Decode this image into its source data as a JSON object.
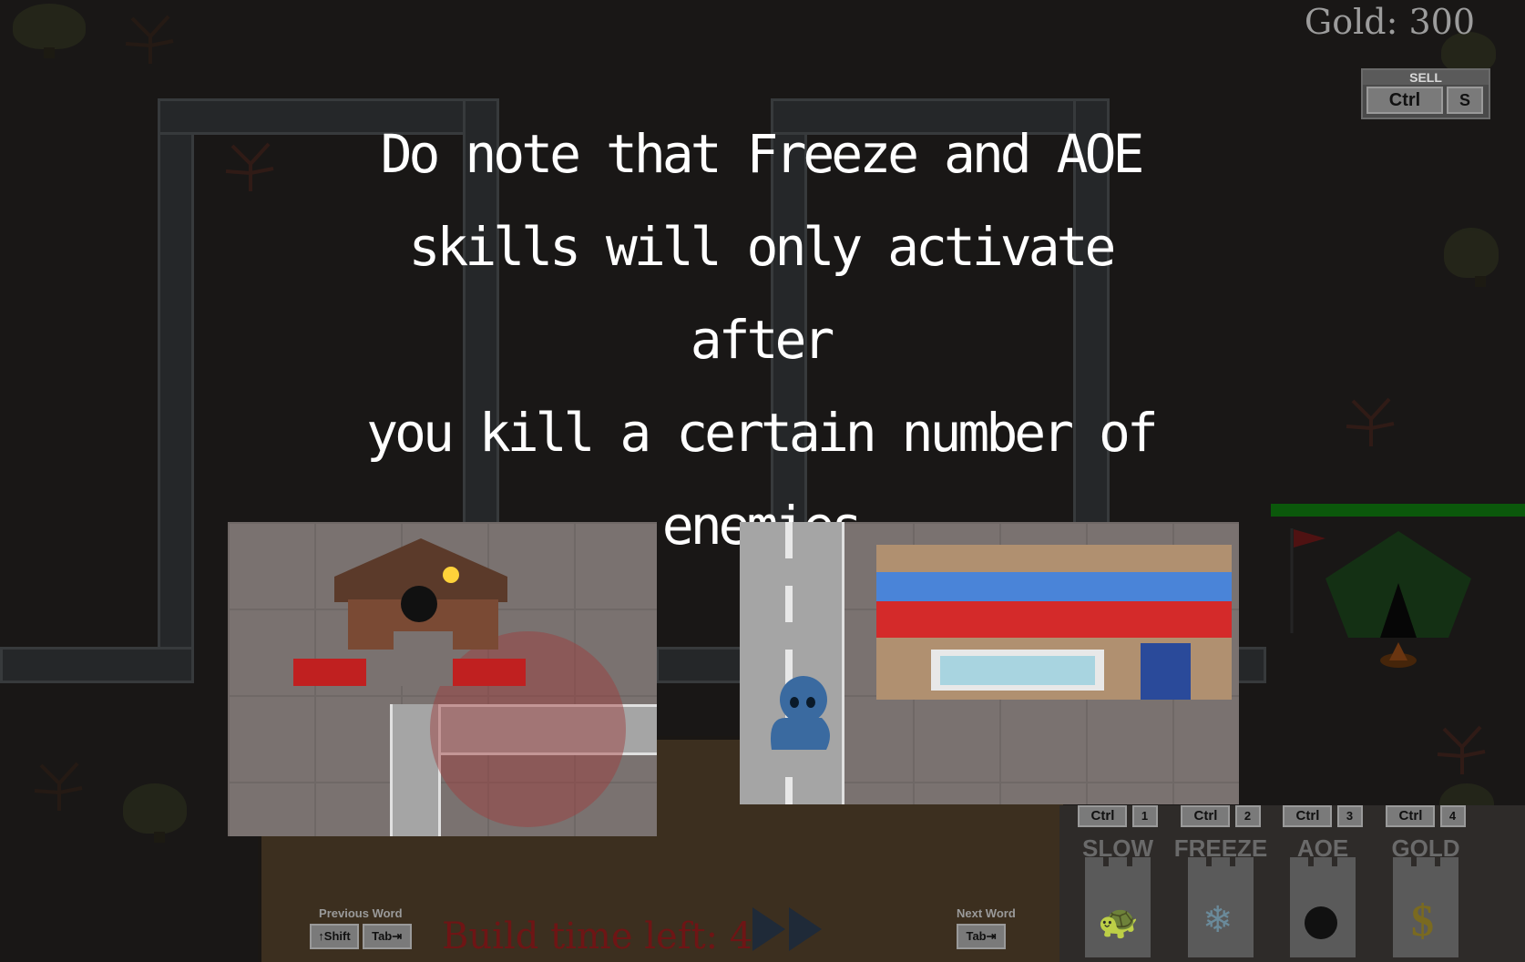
{
  "hud": {
    "gold": "Gold: 300",
    "sell": {
      "label": "SELL",
      "modifier": "Ctrl",
      "key": "S"
    }
  },
  "tutorial": {
    "lines": [
      "Do note that Freeze and AOE",
      "skills will only activate after",
      "you kill a certain number of",
      "enemies"
    ]
  },
  "build": {
    "time_left": "Build time left: 4"
  },
  "nav": {
    "previous": {
      "label": "Previous Word",
      "keys": [
        "↑Shift",
        "Tab⇥"
      ]
    },
    "next": {
      "label": "Next Word",
      "key": "Tab⇥"
    }
  },
  "skills": [
    {
      "modifier": "Ctrl",
      "key": "1",
      "name": "SLOW",
      "icon": "turtle-icon"
    },
    {
      "modifier": "Ctrl",
      "key": "2",
      "name": "FREEZE",
      "icon": "snowflake-icon"
    },
    {
      "modifier": "Ctrl",
      "key": "3",
      "name": "AOE",
      "icon": "bomb-icon"
    },
    {
      "modifier": "Ctrl",
      "key": "4",
      "name": "GOLD",
      "icon": "dollar-icon"
    }
  ],
  "base": {
    "health_fraction": 1.0
  },
  "colors": {
    "health": "#118811",
    "build_time": "#6e1515",
    "hud_text": "#9c9c9c"
  }
}
